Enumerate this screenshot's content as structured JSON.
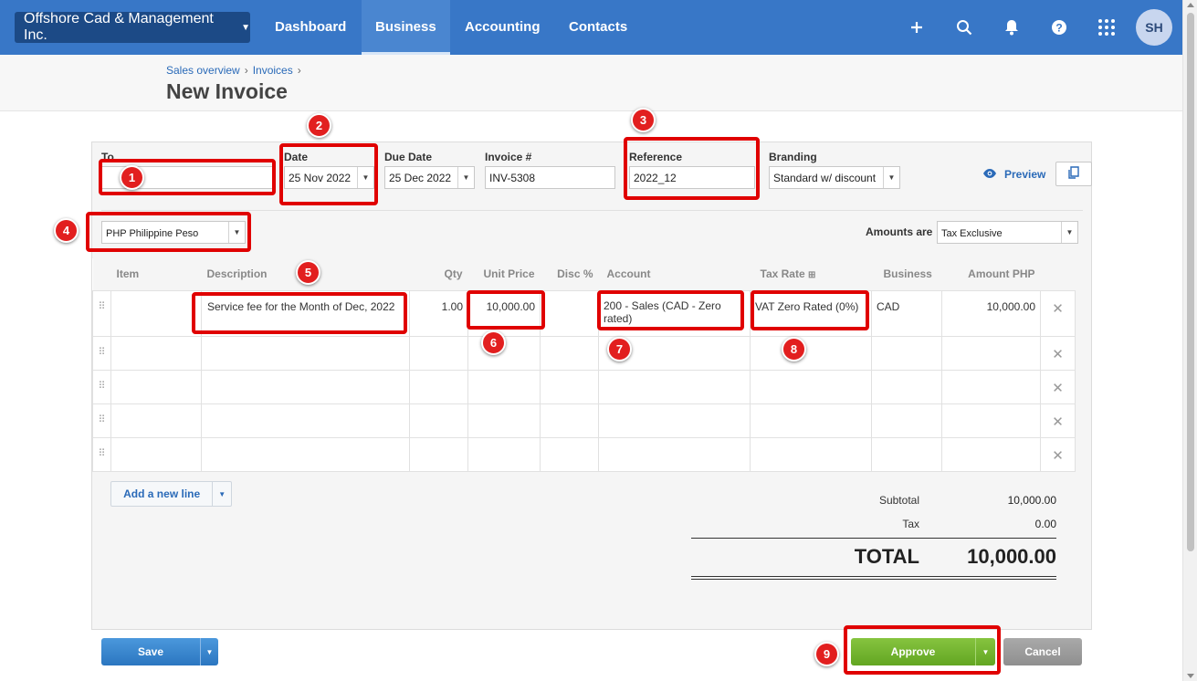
{
  "topnav": {
    "org": "Offshore Cad & Management Inc.",
    "items": [
      {
        "label": "Dashboard"
      },
      {
        "label": "Business"
      },
      {
        "label": "Accounting"
      },
      {
        "label": "Contacts"
      }
    ],
    "active": "Business",
    "avatar": "SH",
    "icons": [
      "plus-icon",
      "search-icon",
      "bell-icon",
      "help-icon",
      "apps-grid-icon"
    ]
  },
  "header": {
    "breadcrumb": [
      "Sales overview",
      "Invoices"
    ],
    "title": "New Invoice"
  },
  "form": {
    "to_label": "To",
    "to_value": "",
    "date_label": "Date",
    "date_value": "25 Nov 2022",
    "due_label": "Due Date",
    "due_value": "25 Dec 2022",
    "invoice_label": "Invoice #",
    "invoice_value": "INV-5308",
    "reference_label": "Reference",
    "reference_value": "2022_12",
    "branding_label": "Branding",
    "branding_value": "Standard w/ discount",
    "preview_label": "Preview",
    "currency_value": "PHP Philippine Peso",
    "amounts_label": "Amounts are",
    "amounts_value": "Tax Exclusive"
  },
  "table": {
    "headers": {
      "item": "Item",
      "description": "Description",
      "qty": "Qty",
      "unit_price": "Unit Price",
      "disc": "Disc %",
      "account": "Account",
      "tax_rate": "Tax Rate",
      "business": "Business",
      "amount": "Amount PHP"
    },
    "rows": [
      {
        "item": "",
        "description": "Service fee for the Month of Dec, 2022",
        "qty": "1.00",
        "unit_price": "10,000.00",
        "disc": "",
        "account": "200 - Sales (CAD - Zero rated)",
        "tax_rate": "VAT Zero Rated (0%)",
        "business": "CAD",
        "amount": "10,000.00"
      }
    ],
    "empty_rows": 4,
    "add_line_label": "Add a new line"
  },
  "totals": {
    "subtotal_label": "Subtotal",
    "subtotal_value": "10,000.00",
    "tax_label": "Tax",
    "tax_value": "0.00",
    "total_label": "TOTAL",
    "total_value": "10,000.00"
  },
  "footer": {
    "save_label": "Save",
    "approve_label": "Approve",
    "cancel_label": "Cancel"
  },
  "annotations": [
    "1",
    "2",
    "3",
    "4",
    "5",
    "6",
    "7",
    "8",
    "9"
  ],
  "colors": {
    "nav": "#3877c7",
    "org_button": "#1c4a86",
    "approve": "#6cb42c",
    "save": "#3a88d0",
    "highlight": "#e00000"
  }
}
